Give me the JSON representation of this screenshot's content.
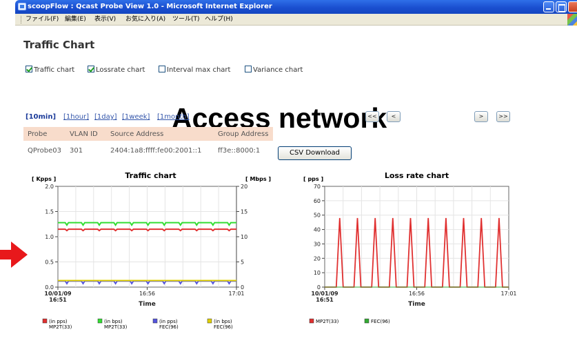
{
  "window": {
    "title": "scoopFlow : Qcast Probe View 1.0 - Microsoft Internet Explorer"
  },
  "menu": [
    "ファイル(F)",
    "編集(E)",
    "表示(V)",
    "お気に入り(A)",
    "ツール(T)",
    "ヘルプ(H)"
  ],
  "page": {
    "title": "Traffic Chart",
    "overlay": "Access network"
  },
  "options": [
    {
      "label": "Traffic chart",
      "checked": true
    },
    {
      "label": "Lossrate chart",
      "checked": true
    },
    {
      "label": "Interval max chart",
      "checked": false
    },
    {
      "label": "Variance chart",
      "checked": false
    }
  ],
  "ranges": [
    {
      "label": "[10min]",
      "selected": true
    },
    {
      "label": "[1hour]",
      "selected": false
    },
    {
      "label": "[1day]",
      "selected": false
    },
    {
      "label": "[1week]",
      "selected": false
    },
    {
      "label": "[1month]",
      "selected": false
    }
  ],
  "nav": {
    "first": "<<",
    "prev": "<",
    "next": ">",
    "last": ">>"
  },
  "table": {
    "headers": [
      "Probe",
      "VLAN ID",
      "Source Address",
      "Group Address"
    ],
    "row": [
      "QProbe03",
      "301",
      "2404:1a8:ffff:fe00:2001::1",
      "ff3e::8000:1"
    ]
  },
  "csv_button": "CSV Download",
  "chart_data": [
    {
      "type": "line",
      "title": "Traffic chart",
      "ylabel": "[ Kpps ]",
      "ylabel_right": "[ Mbps ]",
      "xlabel": "Time",
      "x_ticks": [
        "10/01/09 16:51",
        "16:56",
        "17:01"
      ],
      "y_ticks": [
        "0.0",
        "0.5",
        "1.0",
        "1.5",
        "2.0"
      ],
      "y2_ticks": [
        "0",
        "5",
        "10",
        "15",
        "20"
      ],
      "ylim": [
        0,
        2.0
      ],
      "y2lim": [
        0,
        20
      ],
      "grid": true,
      "legend_position": "bottom",
      "series": [
        {
          "name": "(in pps) MP2T(33)",
          "color": "#e03030",
          "axis": "left",
          "base": 1.15,
          "dip": 1.12
        },
        {
          "name": "(in bps) MP2T(33)",
          "color": "#33dd33",
          "axis": "left",
          "base": 1.28,
          "dip": 1.23
        },
        {
          "name": "(in pps) FEC(96)",
          "color": "#5555dd",
          "axis": "left",
          "base": 0.12,
          "dip": 0.07
        },
        {
          "name": "(in bps) FEC(96)",
          "color": "#e0d000",
          "axis": "left",
          "base": 0.13,
          "dip": 0.13
        }
      ]
    },
    {
      "type": "line",
      "title": "Loss rate chart",
      "ylabel": "[ pps ]",
      "xlabel": "Time",
      "x_ticks": [
        "10/01/09 16:51",
        "16:56",
        "17:01"
      ],
      "y_ticks": [
        "0",
        "10",
        "20",
        "30",
        "40",
        "50",
        "60",
        "70"
      ],
      "ylim": [
        0,
        70
      ],
      "grid": true,
      "legend_position": "bottom",
      "spike_count": 10,
      "spike_value": 48,
      "series": [
        {
          "name": "MP2T(33)",
          "color": "#e03030"
        },
        {
          "name": "FEC(96)",
          "color": "#33aa33"
        }
      ]
    }
  ]
}
